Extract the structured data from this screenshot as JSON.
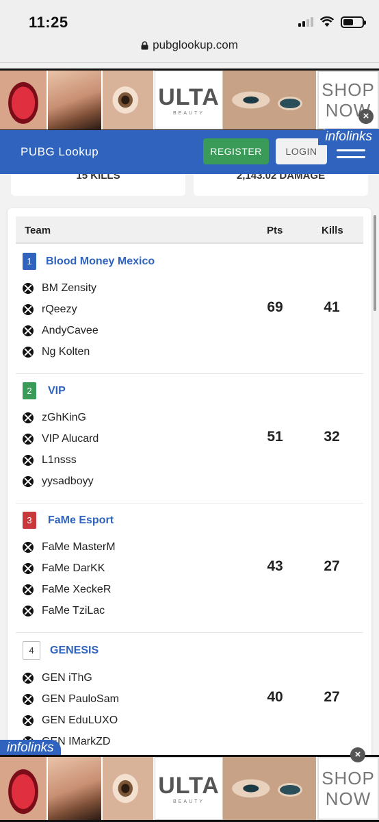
{
  "status_bar": {
    "time": "11:25"
  },
  "browser": {
    "url": "pubglookup.com"
  },
  "ad": {
    "brand": "ULTA",
    "brand_sub": "BEAUTY",
    "cta_line1": "SHOP",
    "cta_line2": "NOW",
    "network": "infolinks",
    "close": "×"
  },
  "header": {
    "brand": "PUBG Lookup",
    "register_label": "REGISTER",
    "login_label": "LOGIN"
  },
  "stats": {
    "kills": "15 KILLS",
    "damage": "2,143.02 DAMAGE"
  },
  "table": {
    "columns": {
      "team": "Team",
      "pts": "Pts",
      "kills": "Kills"
    },
    "teams": [
      {
        "rank": "1",
        "name": "Blood Money Mexico",
        "players": [
          "BM Zensity",
          "rQeezy",
          "AndyCavee",
          "Ng Kolten"
        ],
        "pts": "69",
        "kills": "41"
      },
      {
        "rank": "2",
        "name": "VIP",
        "players": [
          "zGhKinG",
          "VIP Alucard",
          "L1nsss",
          "yysadboyy"
        ],
        "pts": "51",
        "kills": "32"
      },
      {
        "rank": "3",
        "name": "FaMe Esport",
        "players": [
          "FaMe MasterM",
          "FaMe DarKK",
          "FaMe XeckeR",
          "FaMe TziLac"
        ],
        "pts": "43",
        "kills": "27"
      },
      {
        "rank": "4",
        "name": "GENESIS",
        "players": [
          "GEN iThG",
          "GEN PauloSam",
          "GEN EduLUXO",
          "GEN IMarkZD"
        ],
        "pts": "40",
        "kills": "27"
      }
    ]
  },
  "colors": {
    "primary": "#2f63be",
    "green": "#3a9a58",
    "red": "#c9393b"
  },
  "icons": {
    "player_platform": "xbox-icon"
  }
}
